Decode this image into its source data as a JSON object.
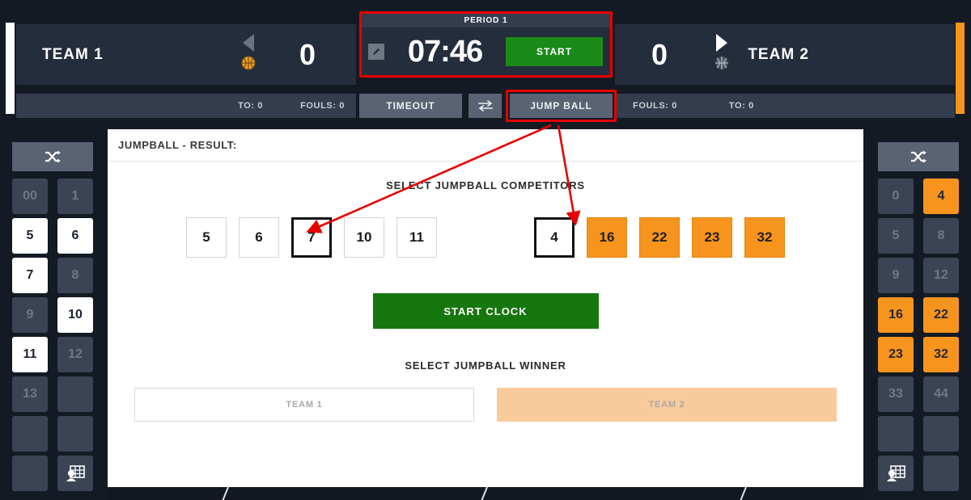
{
  "scoreboard": {
    "team1": {
      "name": "TEAM 1",
      "score": "0",
      "timeouts_label": "TO: 0",
      "fouls_label": "FOULS: 0",
      "possession_arrow": "arrow-left-icon",
      "ball_icon": "basketball-icon-active",
      "accent_color": "#ffffff"
    },
    "team2": {
      "name": "TEAM 2",
      "score": "0",
      "fouls_label": "FOULS: 0",
      "timeouts_label": "TO: 0",
      "possession_arrow": "arrow-right-icon",
      "ball_icon": "basketball-icon-inactive",
      "accent_color": "#f7941e"
    },
    "clock": {
      "period_label": "PERIOD 1",
      "time": "07:46",
      "edit_icon": "pencil-icon",
      "start_label": "START",
      "start_color": "#1a8a18"
    },
    "actions": {
      "timeout_label": "TIMEOUT",
      "swap_icon": "swap-arrows-icon",
      "jumpball_label": "JUMP BALL"
    },
    "highlight_color": "#e60000"
  },
  "sidebar_left": {
    "shuffle_icon": "shuffle-icon",
    "roster_icon": "roster-grid-icon",
    "active_color": "#ffffff",
    "players": [
      {
        "num": "00",
        "state": "off"
      },
      {
        "num": "1",
        "state": "off"
      },
      {
        "num": "5",
        "state": "on"
      },
      {
        "num": "6",
        "state": "on"
      },
      {
        "num": "7",
        "state": "on"
      },
      {
        "num": "8",
        "state": "off"
      },
      {
        "num": "9",
        "state": "off"
      },
      {
        "num": "10",
        "state": "on"
      },
      {
        "num": "11",
        "state": "on"
      },
      {
        "num": "12",
        "state": "off"
      },
      {
        "num": "13",
        "state": "off"
      },
      {
        "num": "",
        "state": "blank"
      },
      {
        "num": "",
        "state": "blank"
      },
      {
        "num": "",
        "state": "blank"
      }
    ]
  },
  "sidebar_right": {
    "shuffle_icon": "shuffle-icon",
    "roster_icon": "roster-grid-icon",
    "active_color": "#f7941e",
    "players": [
      {
        "num": "0",
        "state": "off"
      },
      {
        "num": "4",
        "state": "on"
      },
      {
        "num": "5",
        "state": "off"
      },
      {
        "num": "8",
        "state": "off"
      },
      {
        "num": "9",
        "state": "off"
      },
      {
        "num": "12",
        "state": "off"
      },
      {
        "num": "16",
        "state": "on"
      },
      {
        "num": "22",
        "state": "on"
      },
      {
        "num": "23",
        "state": "on"
      },
      {
        "num": "32",
        "state": "on"
      },
      {
        "num": "33",
        "state": "off"
      },
      {
        "num": "44",
        "state": "off"
      },
      {
        "num": "",
        "state": "blank"
      },
      {
        "num": "",
        "state": "blank"
      }
    ]
  },
  "main": {
    "header_title": "JUMPBALL - RESULT:",
    "competitors_label": "SELECT JUMPBALL COMPETITORS",
    "team1_competitors": [
      {
        "num": "5",
        "selected": false
      },
      {
        "num": "6",
        "selected": false
      },
      {
        "num": "7",
        "selected": true
      },
      {
        "num": "10",
        "selected": false
      },
      {
        "num": "11",
        "selected": false
      }
    ],
    "team2_competitors": [
      {
        "num": "4",
        "selected": true
      },
      {
        "num": "16",
        "selected": false
      },
      {
        "num": "22",
        "selected": false
      },
      {
        "num": "23",
        "selected": false
      },
      {
        "num": "32",
        "selected": false
      }
    ],
    "start_clock_label": "START CLOCK",
    "winner_label": "SELECT JUMPBALL WINNER",
    "winner_team1_label": "TEAM 1",
    "winner_team2_label": "TEAM 2"
  }
}
